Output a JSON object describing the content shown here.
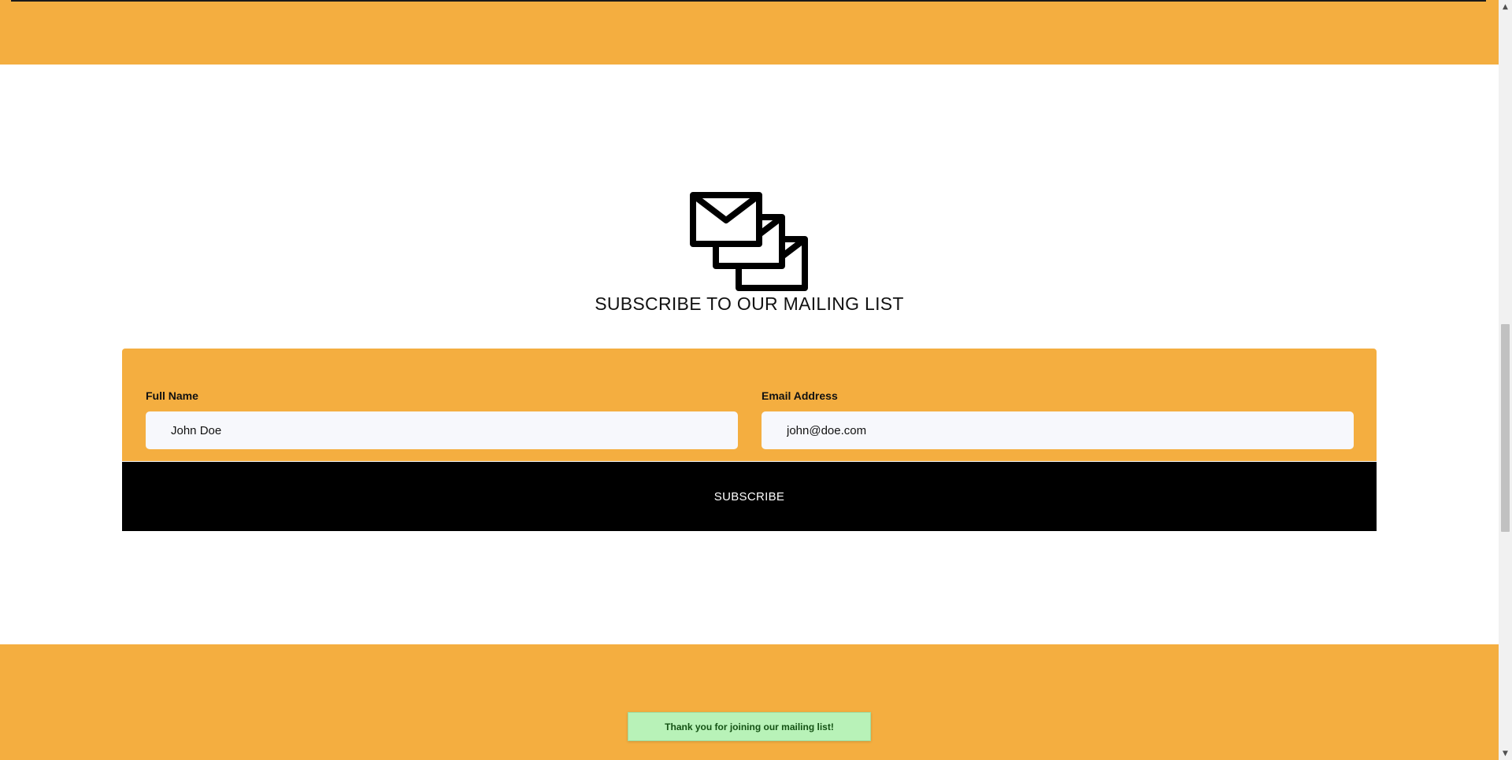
{
  "subscribe_section": {
    "title": "SUBSCRIBE TO OUR MAILING LIST",
    "icon": "multiple-envelopes-icon"
  },
  "form": {
    "name_label": "Full Name",
    "name_value": "John Doe",
    "email_label": "Email Address",
    "email_value": "john@doe.com",
    "submit_label": "SUBSCRIBE"
  },
  "toast": {
    "message": "Thank you for joining our mailing list!"
  },
  "scrollbar": {
    "up_icon": "scroll-up-arrow-icon",
    "down_icon": "scroll-down-arrow-icon"
  },
  "colors": {
    "accent": "#f4ae40",
    "button": "#000000",
    "input_bg": "#f7f8fc",
    "toast_bg": "#b8f2b8",
    "toast_text": "#145214"
  }
}
